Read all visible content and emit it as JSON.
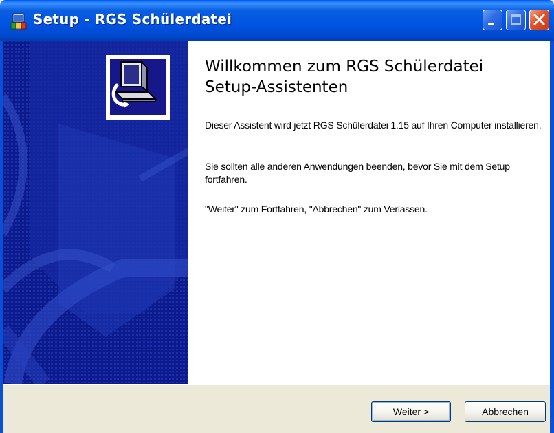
{
  "window": {
    "title": "Setup - RGS Schülerdatei",
    "controls": [
      "minimize-icon",
      "maximize-icon",
      "close-icon"
    ],
    "title_icon": "setup-icon"
  },
  "sidebar": {
    "background_color": "#0b1a8c",
    "logo_icon": "computer-install-icon"
  },
  "main": {
    "heading": "Willkommen zum RGS Schülerdatei Setup-Assistenten",
    "paragraphs": [
      "Dieser Assistent wird jetzt RGS Schülerdatei 1.15 auf Ihren Computer installieren.",
      "Sie sollten alle anderen Anwendungen beenden, bevor Sie mit dem Setup fortfahren.",
      "\"Weiter\" zum Fortfahren, \"Abbrechen\" zum Verlassen."
    ]
  },
  "buttons": {
    "next": "Weiter >",
    "cancel": "Abbrechen"
  },
  "colors": {
    "titlebar": "#0054e3",
    "close_button": "#e0542a",
    "dialog_face": "#ece9d8"
  }
}
